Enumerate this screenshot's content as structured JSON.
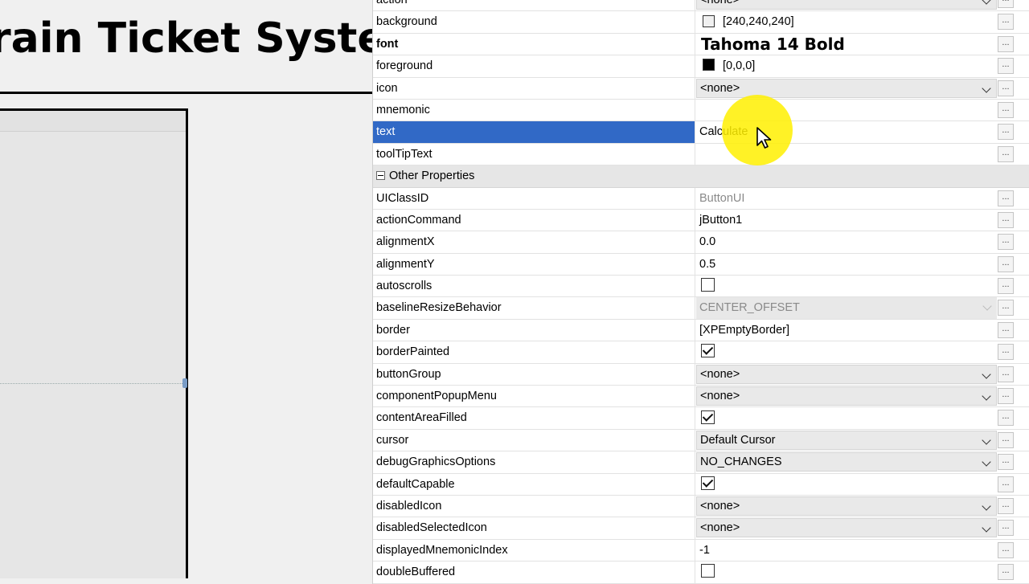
{
  "designer": {
    "form_title": "rain Ticket Syster"
  },
  "property_sheet": {
    "rows_top": [
      {
        "name": "action",
        "value": "<none>",
        "kind": "combo"
      },
      {
        "name": "background",
        "value": "[240,240,240]",
        "kind": "color",
        "swatch": "#f0f0f0"
      },
      {
        "name": "font",
        "value": "Tahoma 14 Bold",
        "kind": "font"
      },
      {
        "name": "foreground",
        "value": "[0,0,0]",
        "kind": "color",
        "swatch": "#000000"
      },
      {
        "name": "icon",
        "value": "<none>",
        "kind": "combo"
      },
      {
        "name": "mnemonic",
        "value": "",
        "kind": "text"
      },
      {
        "name": "text",
        "value": "Calculate",
        "kind": "text",
        "selected": true
      },
      {
        "name": "toolTipText",
        "value": "",
        "kind": "text"
      }
    ],
    "category": "Other Properties",
    "rows_other": [
      {
        "name": "UIClassID",
        "value": "ButtonUI",
        "kind": "readonly"
      },
      {
        "name": "actionCommand",
        "value": "jButton1",
        "kind": "text"
      },
      {
        "name": "alignmentX",
        "value": "0.0",
        "kind": "text"
      },
      {
        "name": "alignmentY",
        "value": "0.5",
        "kind": "text"
      },
      {
        "name": "autoscrolls",
        "value": false,
        "kind": "checkbox"
      },
      {
        "name": "baselineResizeBehavior",
        "value": "CENTER_OFFSET",
        "kind": "combo-disabled"
      },
      {
        "name": "border",
        "value": "[XPEmptyBorder]",
        "kind": "text"
      },
      {
        "name": "borderPainted",
        "value": true,
        "kind": "checkbox"
      },
      {
        "name": "buttonGroup",
        "value": "<none>",
        "kind": "combo"
      },
      {
        "name": "componentPopupMenu",
        "value": "<none>",
        "kind": "combo"
      },
      {
        "name": "contentAreaFilled",
        "value": true,
        "kind": "checkbox"
      },
      {
        "name": "cursor",
        "value": "Default Cursor",
        "kind": "combo"
      },
      {
        "name": "debugGraphicsOptions",
        "value": "NO_CHANGES",
        "kind": "combo"
      },
      {
        "name": "defaultCapable",
        "value": true,
        "kind": "checkbox"
      },
      {
        "name": "disabledIcon",
        "value": "<none>",
        "kind": "combo"
      },
      {
        "name": "disabledSelectedIcon",
        "value": "<none>",
        "kind": "combo"
      },
      {
        "name": "displayedMnemonicIndex",
        "value": "-1",
        "kind": "text"
      },
      {
        "name": "doubleBuffered",
        "value": false,
        "kind": "checkbox"
      }
    ],
    "ellipsis_label": "...",
    "selected_color": "#3169c6"
  },
  "icons": {
    "collapse": "minus-square-icon",
    "dropdown": "chevron-down-icon",
    "cursor": "mouse-pointer-icon"
  }
}
